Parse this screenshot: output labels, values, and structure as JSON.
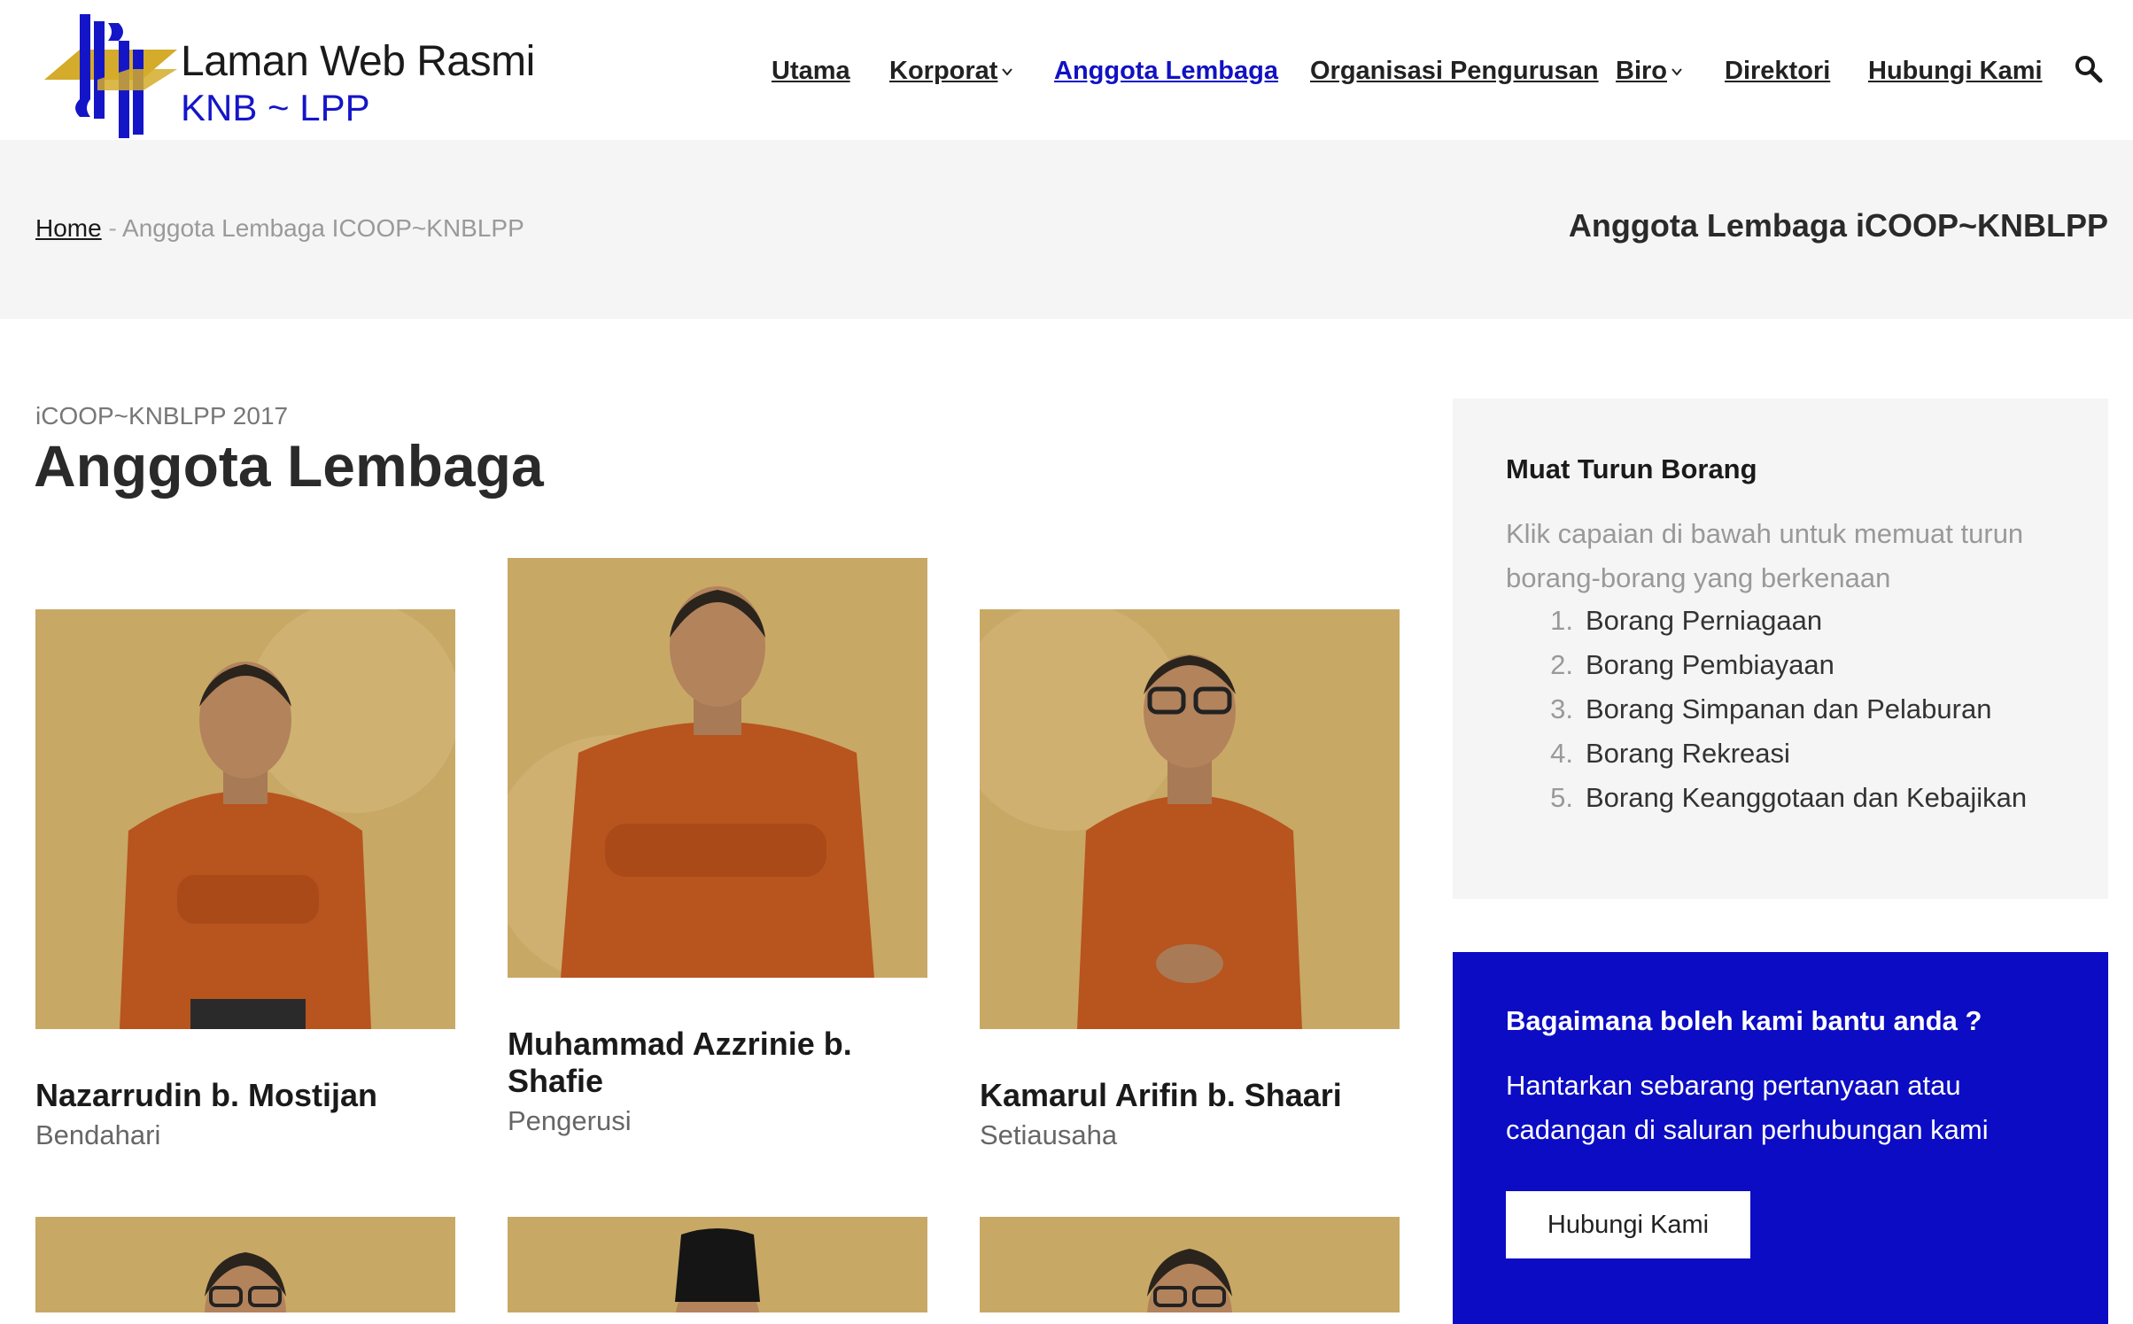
{
  "brand": {
    "line1": "Laman Web Rasmi",
    "line2": "KNB ~ LPP",
    "colors": {
      "blue": "#1515c8",
      "gold": "#d4ab2a"
    }
  },
  "nav": {
    "items": [
      {
        "label": "Utama"
      },
      {
        "label": "Korporat",
        "dropdown": true
      },
      {
        "label": "Anggota Lembaga",
        "active": true
      },
      {
        "label": "Organisasi Pengurusan"
      },
      {
        "label": "Biro",
        "dropdown": true
      },
      {
        "label": "Direktori"
      },
      {
        "label": "Hubungi Kami"
      }
    ],
    "search_icon": "search-icon"
  },
  "breadcrumb": {
    "home": "Home",
    "separator": " - ",
    "current": "Anggota Lembaga ICOOP~KNBLPP"
  },
  "band_title": "Anggota Lembaga iCOOP~KNBLPP",
  "main": {
    "kicker": "iCOOP~KNBLPP 2017",
    "title": "Anggota Lembaga",
    "members": [
      {
        "name": "Nazarrudin b. Mostijan",
        "role": "Bendahari"
      },
      {
        "name": "Muhammad Azzrinie b. Shafie",
        "role": "Pengerusi"
      },
      {
        "name": "Kamarul Arifin b. Shaari",
        "role": "Setiausaha"
      }
    ]
  },
  "sidebar": {
    "download": {
      "title": "Muat Turun Borang",
      "description": "Klik capaian di bawah untuk memuat turun borang-borang yang berkenaan",
      "forms": [
        {
          "num": "1.",
          "label": "Borang Perniagaan"
        },
        {
          "num": "2.",
          "label": "Borang Pembiayaan"
        },
        {
          "num": "3.",
          "label": "Borang Simpanan dan Pelaburan"
        },
        {
          "num": "4.",
          "label": "Borang Rekreasi"
        },
        {
          "num": "5.",
          "label": "Borang Keanggotaan dan Kebajikan"
        }
      ]
    },
    "help": {
      "title": "Bagaimana boleh kami bantu anda ?",
      "description": "Hantarkan sebarang pertanyaan atau cadangan di saluran perhubungan kami",
      "button_label": "Hubungi Kami",
      "color": "#0c0cc4"
    }
  }
}
